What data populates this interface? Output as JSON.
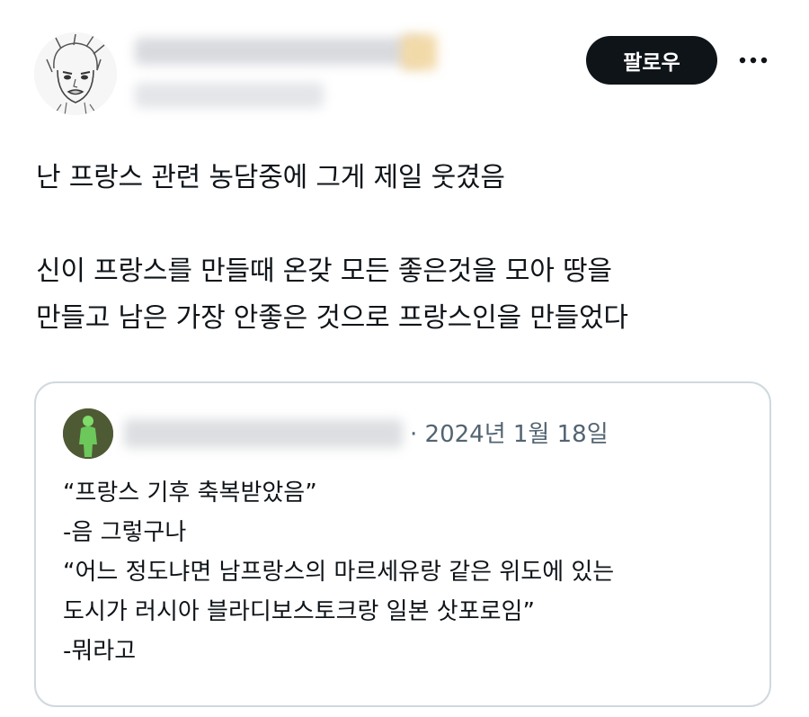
{
  "header": {
    "follow_label": "팔로우",
    "more_label": "···"
  },
  "tweet": {
    "text": "난 프랑스 관련 농담중에 그게 제일 웃겼음\n\n신이 프랑스를 만들때 온갖 모든 좋은것을 모아 땅을\n만들고 남은 가장 안좋은 것으로 프랑스인을 만들었다"
  },
  "quote": {
    "date": "· 2024년 1월 18일",
    "text": "“프랑스 기후 축복받았음”\n-음 그렇구나\n“어느 정도냐면 남프랑스의 마르세유랑 같은 위도에 있는\n도시가 러시아 블라디보스토크랑 일본 삿포로임”\n-뭐라고"
  },
  "icons": {
    "avatar": "sketch-portrait-avatar",
    "quote_avatar": "green-figure-avatar",
    "more": "more-horizontal-icon"
  },
  "colors": {
    "follow_bg": "#0f1419",
    "border": "#cfd9de",
    "secondary_text": "#536471"
  }
}
